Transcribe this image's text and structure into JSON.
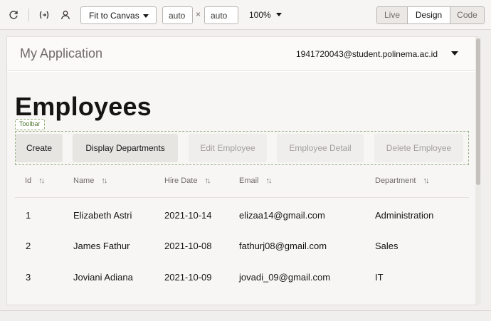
{
  "toolbar": {
    "fit_label": "Fit to Canvas",
    "width_value": "auto",
    "height_value": "auto",
    "times": "×",
    "zoom": "100%",
    "modes": [
      "Live",
      "Design",
      "Code"
    ],
    "active_mode": "Design"
  },
  "app": {
    "title": "My Application",
    "user": "1941720043@student.polinema.ac.id"
  },
  "page": {
    "heading": "Employees",
    "toolbar_tag": "Toolbar",
    "buttons": [
      {
        "label": "Create",
        "enabled": true
      },
      {
        "label": "Display Departments",
        "enabled": true
      },
      {
        "label": "Edit Employee",
        "enabled": false
      },
      {
        "label": "Employee Detail",
        "enabled": false
      },
      {
        "label": "Delete Employee",
        "enabled": false
      }
    ]
  },
  "table": {
    "headers": [
      "Id",
      "Name",
      "Hire Date",
      "Email",
      "Department"
    ],
    "rows": [
      [
        "1",
        "Elizabeth Astri",
        "2021-10-14",
        "elizaa14@gmail.com",
        "Administration"
      ],
      [
        "2",
        "James Fathur",
        "2021-10-08",
        "fathurj08@gmail.com",
        "Sales"
      ],
      [
        "3",
        "Joviani Adiana",
        "2021-10-09",
        "jovadi_09@gmail.com",
        "IT"
      ]
    ]
  },
  "icons": [
    "refresh-icon",
    "code-brackets-icon",
    "user-icon",
    "sort-icon"
  ]
}
